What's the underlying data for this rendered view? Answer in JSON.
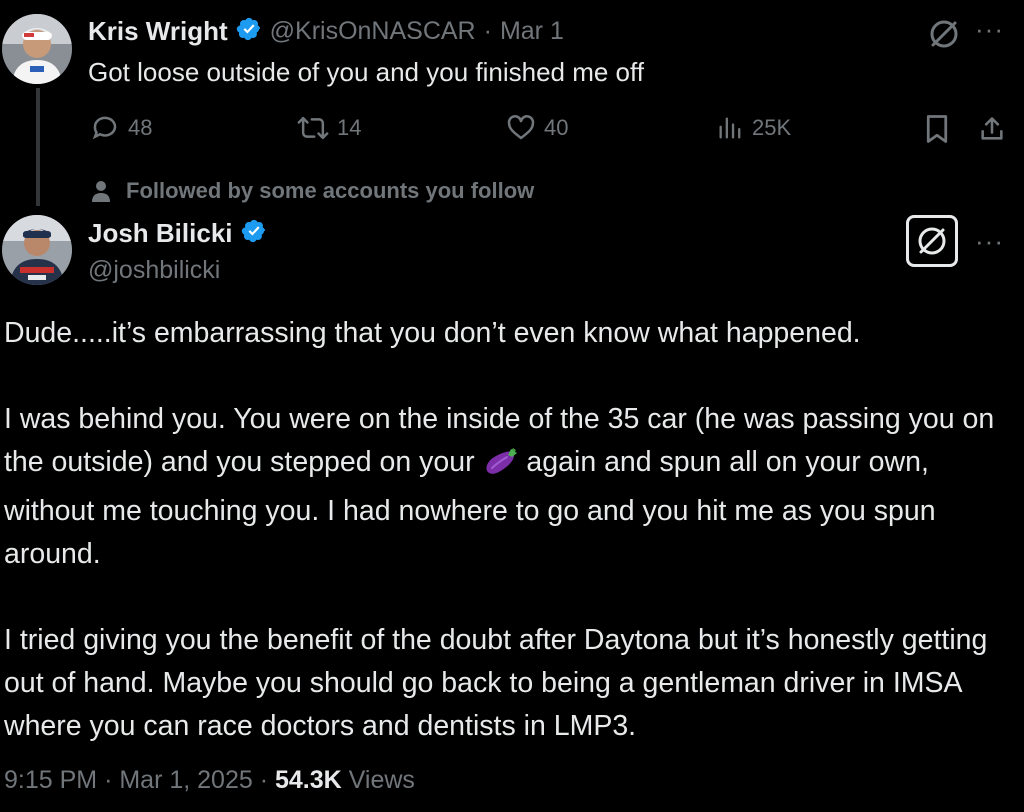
{
  "reply_to": {
    "name": "Kris Wright",
    "handle": "@KrisOnNASCAR",
    "separator": "·",
    "date": "Mar 1",
    "text": "Got loose outside of you and you finished me off",
    "replies": "48",
    "reposts": "14",
    "likes": "40",
    "views": "25K",
    "more": "···"
  },
  "social_context": "Followed by some accounts you follow",
  "main_tweet": {
    "name": "Josh Bilicki",
    "handle": "@joshbilicki",
    "more": "···",
    "paragraph1": "Dude.....it’s embarrassing that you don’t even know what happened.",
    "paragraph2_part1": "I was behind you. You were on the inside of the 35 car (he was passing you on the outside) and you stepped on your ",
    "paragraph2_emoji": "eggplant-emoji",
    "paragraph2_part2": " again and spun all on your own, without me touching you. I had nowhere to go and you hit me as you spun around.",
    "paragraph3": "I tried giving you the benefit of the doubt after Daytona but it’s honestly getting out of hand. Maybe you should go back to being a gentleman driver in IMSA where you can race doctors and dentists in LMP3.",
    "time": "9:15 PM",
    "separator": "·",
    "date": "Mar 1, 2025",
    "separator2": "·",
    "views_count": "54.3K",
    "views_label": "Views"
  },
  "colors": {
    "background": "#000000",
    "text": "#e7e9ea",
    "muted": "#71767b",
    "verified": "#1d9bf0",
    "thread_line": "#333639"
  }
}
